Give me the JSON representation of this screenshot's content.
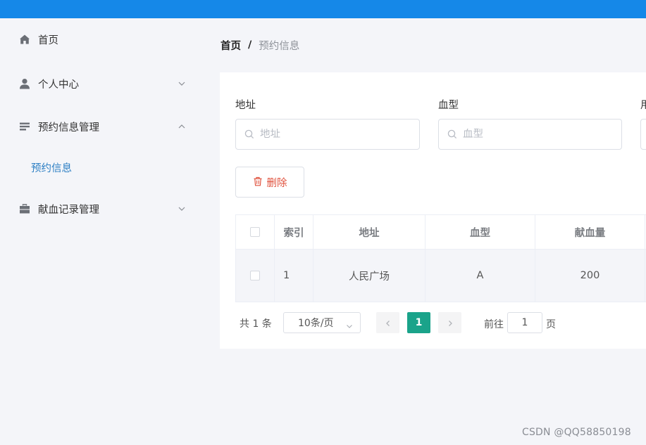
{
  "sidebar": {
    "items": [
      {
        "label": "首页",
        "icon": "home-icon"
      },
      {
        "label": "个人中心",
        "icon": "user-icon",
        "chevron": "chevron-down-icon"
      },
      {
        "label": "预约信息管理",
        "icon": "menu-lines-icon",
        "chevron": "chevron-up-icon",
        "sub": [
          {
            "label": "预约信息"
          }
        ]
      },
      {
        "label": "献血记录管理",
        "icon": "briefcase-icon",
        "chevron": "chevron-down-icon"
      }
    ]
  },
  "breadcrumb": {
    "home": "首页",
    "separator": "/",
    "current": "预约信息"
  },
  "search": {
    "fields": [
      {
        "label": "地址",
        "placeholder": "地址"
      },
      {
        "label": "血型",
        "placeholder": "血型"
      },
      {
        "label": "用"
      }
    ]
  },
  "actions": {
    "delete_label": "删除"
  },
  "table": {
    "columns": [
      "索引",
      "地址",
      "血型",
      "献血量"
    ],
    "rows": [
      {
        "index": "1",
        "address": "人民广场",
        "blood_type": "A",
        "amount": "200"
      }
    ]
  },
  "pagination": {
    "total_text": "共 1 条",
    "page_size": "10条/页",
    "current_page": "1",
    "goto_label": "前往",
    "goto_value": "1",
    "page_suffix": "页"
  },
  "watermark": "CSDN @QQ58850198",
  "colors": {
    "topbar": "#1588e8",
    "active_link": "#2d7fc4",
    "pager_active": "#1aa38a",
    "delete": "#e0533f"
  }
}
